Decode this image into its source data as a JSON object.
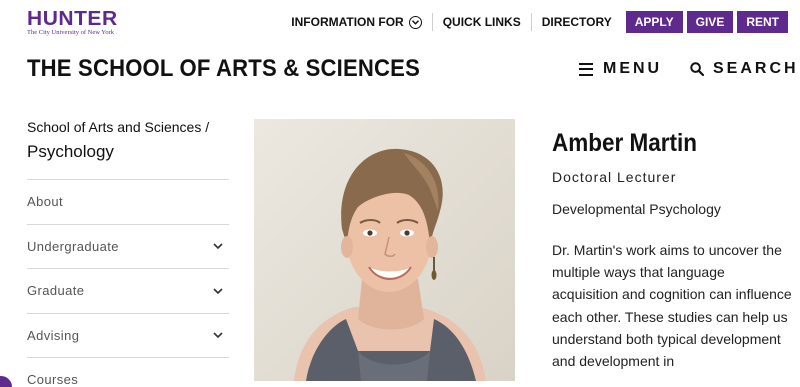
{
  "logo": {
    "word": "HUNTER",
    "sub": "The City University of New York"
  },
  "utility": {
    "info_for": "INFORMATION FOR",
    "quick_links": "QUICK LINKS",
    "directory": "DIRECTORY",
    "apply": "APPLY",
    "give": "GIVE",
    "rent": "RENT"
  },
  "header": {
    "title": "THE SCHOOL OF ARTS & SCIENCES",
    "menu": "MENU",
    "search": "SEARCH"
  },
  "sidebar": {
    "breadcrumb_parent": "School of Arts and Sciences /",
    "breadcrumb_current": "Psychology",
    "items": [
      {
        "label": "About",
        "expandable": false
      },
      {
        "label": "Undergraduate",
        "expandable": true
      },
      {
        "label": "Graduate",
        "expandable": true
      },
      {
        "label": "Advising",
        "expandable": true
      },
      {
        "label": "Courses",
        "expandable": false
      }
    ]
  },
  "profile": {
    "name": "Amber Martin",
    "title": "Doctoral Lecturer",
    "department": "Developmental Psychology",
    "bio": "Dr. Martin's work aims to uncover the multiple ways that language acquisition and cognition can influence each other. These studies can help us understand both typical development and development in"
  },
  "colors": {
    "brand_purple": "#5f2a8e",
    "text": "#111111",
    "divider": "#d8d8d8"
  },
  "icons": [
    "chevron-down-circle-icon",
    "hamburger-icon",
    "search-icon",
    "chevron-down-icon",
    "portrait-photo"
  ]
}
